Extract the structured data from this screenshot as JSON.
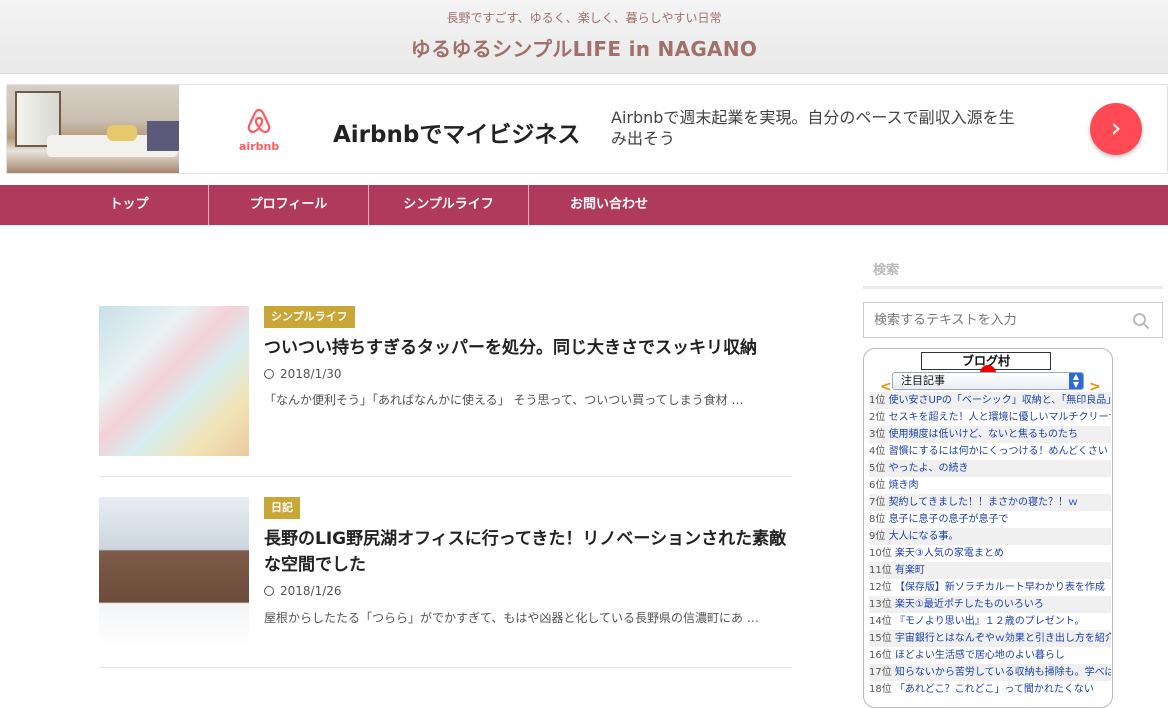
{
  "header": {
    "tagline": "長野ですごす、ゆるく、楽しく、暮らしやすい日常",
    "title": "ゆるゆるシンプルLIFE in NAGANO"
  },
  "ad": {
    "brand": "airbnb",
    "headline": "Airbnbでマイビジネス",
    "body": "Airbnbで週末起業を実現。自分のペースで副収入源を生み出そう",
    "arrow": "›",
    "brand_color": "#ff5a5f"
  },
  "nav": {
    "items": [
      "トップ",
      "プロフィール",
      "シンプルライフ",
      "お問い合わせ"
    ],
    "color": "#b03a5b"
  },
  "posts": [
    {
      "category": "シンプルライフ",
      "title": "ついつい持ちすぎるタッパーを処分。同じ大きさでスッキリ収納",
      "date": "2018/1/30",
      "excerpt": "「なんか便利そう」「あればなんかに使える」 そう思って、ついつい買ってしまう食材 …"
    },
    {
      "category": "日記",
      "title": "長野のLIG野尻湖オフィスに行ってきた！リノベーションされた素敵な空間でした",
      "date": "2018/1/26",
      "excerpt": "屋根からしたたる「つらら」がでかすぎて、もはや凶器と化している長野県の信濃町にあ …"
    }
  ],
  "sidebar": {
    "search_title": "検索",
    "search_placeholder": "検索するテキストを入力",
    "blog_widget": {
      "logo": "ブログ村",
      "select_label": "注目記事",
      "prev": "<",
      "next": ">",
      "items": [
        {
          "rank": "1位",
          "title": "使い安さUPの「ベーシック」収納と、「無印良品」"
        },
        {
          "rank": "2位",
          "title": "セスキを超えた！人と環境に優しいマルチクリーナー"
        },
        {
          "rank": "3位",
          "title": "使用頻度は低いけど、ないと焦るものたち"
        },
        {
          "rank": "4位",
          "title": "習慣にするには何かにくっつける！めんどくさい"
        },
        {
          "rank": "5位",
          "title": "やったよ、の続き"
        },
        {
          "rank": "6位",
          "title": "焼き肉"
        },
        {
          "rank": "7位",
          "title": "契約してきました！！まさかの寝た？！ｗ"
        },
        {
          "rank": "8位",
          "title": "息子に息子の息子が息子で"
        },
        {
          "rank": "9位",
          "title": "大人になる事。"
        },
        {
          "rank": "10位",
          "title": "楽天③人気の家電まとめ"
        },
        {
          "rank": "11位",
          "title": "有楽町"
        },
        {
          "rank": "12位",
          "title": "【保存版】新ソラチカルート早わかり表を作成"
        },
        {
          "rank": "13位",
          "title": "楽天①最近ポチしたものいろいろ"
        },
        {
          "rank": "14位",
          "title": "『モノより思い出』１２歳のプレゼント。"
        },
        {
          "rank": "15位",
          "title": "宇宙銀行とはなんぞやｗ効果と引き出し方を紹介"
        },
        {
          "rank": "16位",
          "title": "ほどよい生活感で居心地のよい暮らし"
        },
        {
          "rank": "17位",
          "title": "知らないから苦労している収納も掃除も。学べば"
        },
        {
          "rank": "18位",
          "title": "「あれどこ？これどこ」って聞かれたくない"
        }
      ]
    }
  }
}
